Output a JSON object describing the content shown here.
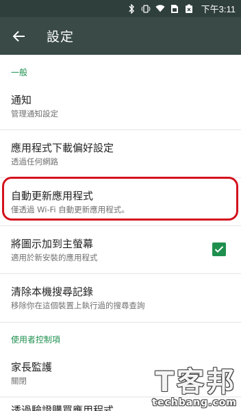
{
  "status_bar": {
    "icons": [
      "bluetooth-icon",
      "vibrate-icon",
      "wifi-icon",
      "sim-icon",
      "battery-icon"
    ],
    "time": "下午3:11"
  },
  "app_bar": {
    "title": "設定",
    "back_icon": "arrow-left-icon"
  },
  "sections": [
    {
      "header": "一般",
      "items": [
        {
          "title": "通知",
          "subtitle": "管理通知設定"
        },
        {
          "title": "應用程式下載偏好設定",
          "subtitle": "透過任何網路"
        },
        {
          "title": "自動更新應用程式",
          "subtitle": "僅透過 Wi-Fi 自動更新應用程式。"
        },
        {
          "title": "將圖示加到主螢幕",
          "subtitle": "適用於新安裝的應用程式",
          "checked": true
        },
        {
          "title": "清除本機搜尋記錄",
          "subtitle": "移除你在這個裝置上執行過的搜尋查詢"
        }
      ]
    },
    {
      "header": "使用者控制項",
      "items": [
        {
          "title": "家長監護",
          "subtitle": "關閉"
        },
        {
          "title": "透過驗證購買應用程式"
        }
      ]
    }
  ],
  "watermark": {
    "cn": "T客邦",
    "en": "techbang.com"
  },
  "colors": {
    "accent": "#1e8f4e",
    "app_bar": "#3a4b47",
    "status_bar": "#2f3f3c",
    "highlight": "#d4101c"
  }
}
